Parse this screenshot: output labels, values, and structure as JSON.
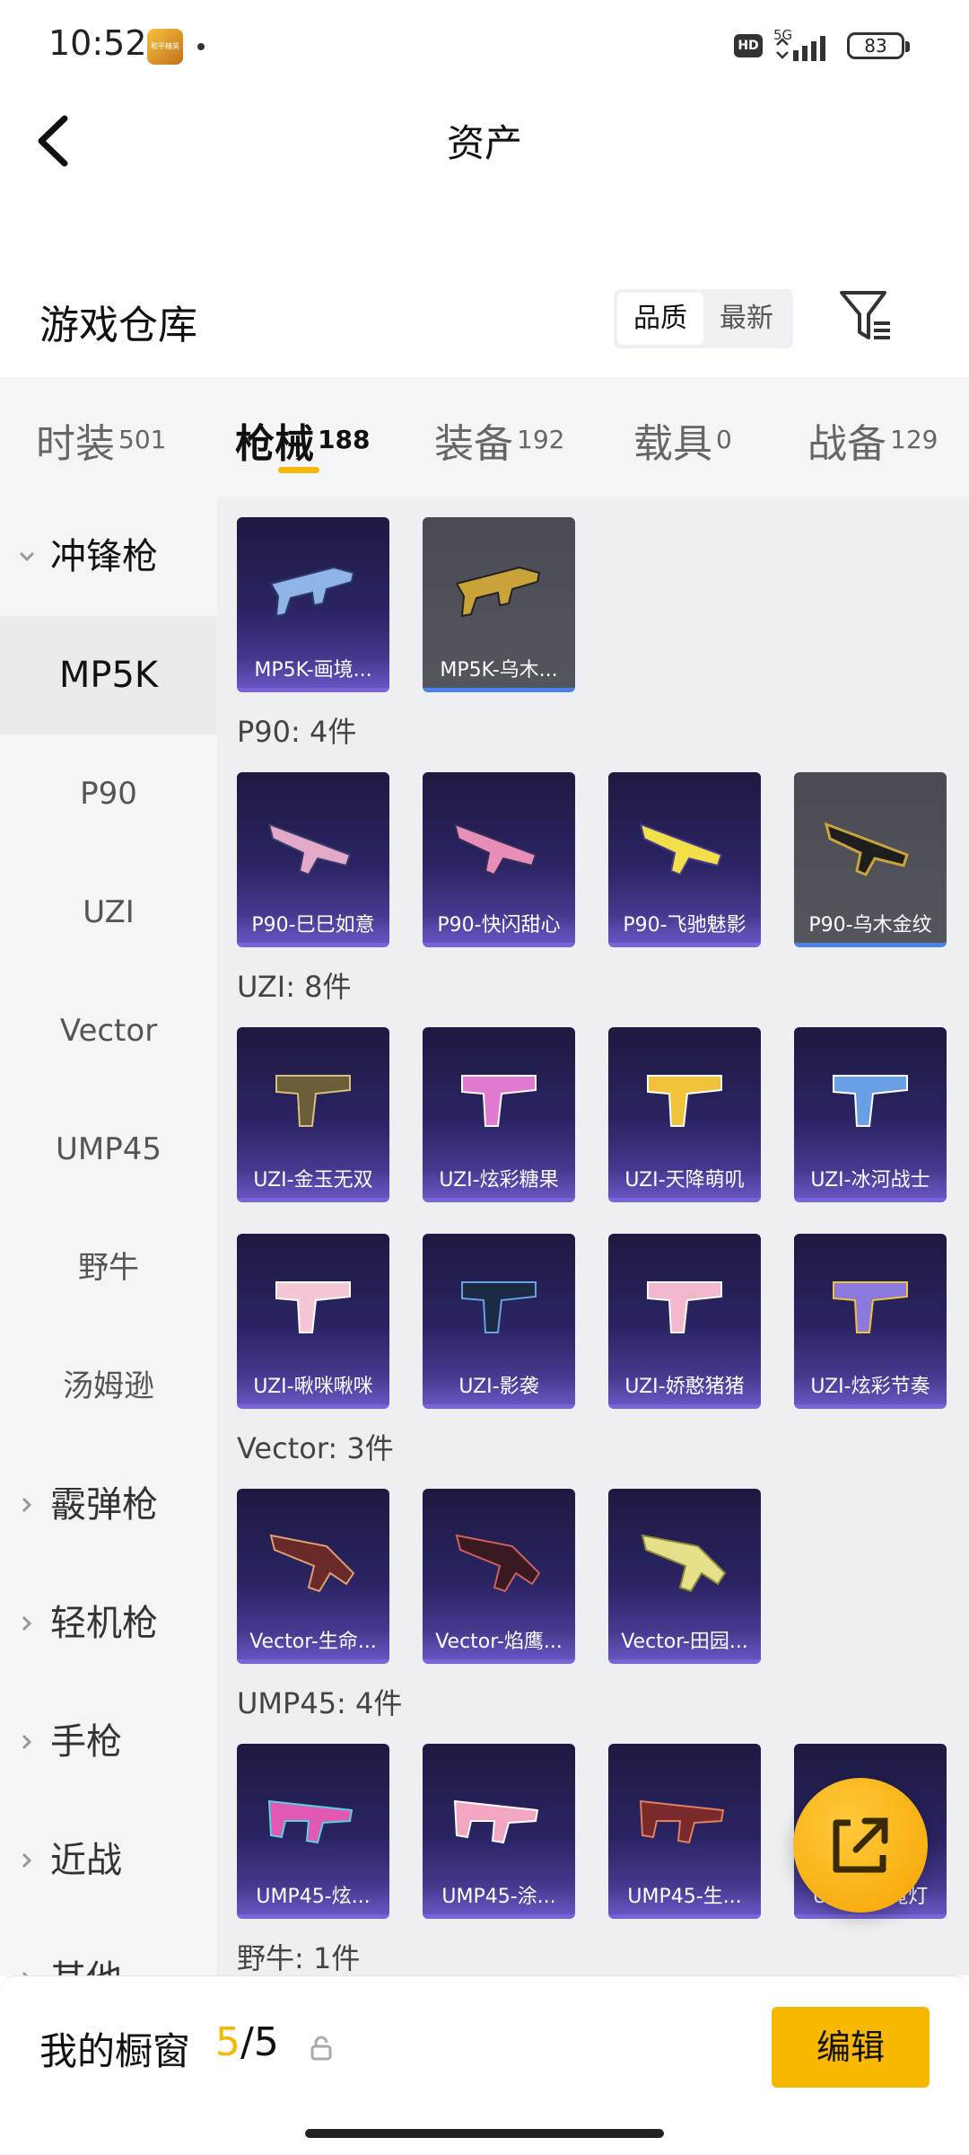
{
  "status_bar": {
    "time": "10:52",
    "network": "5G",
    "hd": "HD",
    "battery": "83",
    "app_icon_text": "和平精英"
  },
  "header": {
    "title": "资产"
  },
  "warehouse": {
    "title": "游戏仓库",
    "sort_options": [
      "品质",
      "最新"
    ],
    "active_sort": "品质"
  },
  "tabs": [
    {
      "name": "时装",
      "count": "501"
    },
    {
      "name": "枪械",
      "count": "188",
      "active": true
    },
    {
      "name": "装备",
      "count": "192"
    },
    {
      "name": "载具",
      "count": "0"
    },
    {
      "name": "战备",
      "count": "129"
    }
  ],
  "sidebar": {
    "groups": [
      {
        "label": "冲锋枪",
        "expanded": true
      },
      {
        "label": "霰弹枪"
      },
      {
        "label": "轻机枪"
      },
      {
        "label": "手枪"
      },
      {
        "label": "近战"
      },
      {
        "label": "其他"
      }
    ],
    "subitems": [
      "MP5K",
      "P90",
      "UZI",
      "Vector",
      "UMP45",
      "野牛",
      "汤姆逊"
    ],
    "active_subitem": "MP5K"
  },
  "sections": [
    {
      "title": "",
      "items": [
        "MP5K-画境...",
        "MP5K-乌木..."
      ]
    },
    {
      "title": "P90: 4件",
      "items": [
        "P90-巳巳如意",
        "P90-快闪甜心",
        "P90-飞驰魅影",
        "P90-乌木金纹"
      ]
    },
    {
      "title": "UZI: 8件",
      "items": [
        "UZI-金玉无双",
        "UZI-炫彩糖果",
        "UZI-天降萌叽",
        "UZI-冰河战士",
        "UZI-啾咪啾咪",
        "UZI-影袭",
        "UZI-娇憨猪猪",
        "UZI-炫彩节奏"
      ]
    },
    {
      "title": "Vector: 3件",
      "items": [
        "Vector-生命...",
        "Vector-焰鹰...",
        "Vector-田园..."
      ]
    },
    {
      "title": "UMP45: 4件",
      "items": [
        "UMP45-炫...",
        "UMP45-涂...",
        "UMP45-生...",
        "UMP45-霓灯"
      ]
    },
    {
      "title": "野牛: 1件",
      "items": []
    }
  ],
  "bottom": {
    "my_window": "我的橱窗",
    "slots_used": "5",
    "slots_total": "/5",
    "edit_label": "编辑"
  },
  "colors": {
    "accent": "#f5b800",
    "card_purple": "#2a2463",
    "card_gray": "#4a4b52"
  }
}
